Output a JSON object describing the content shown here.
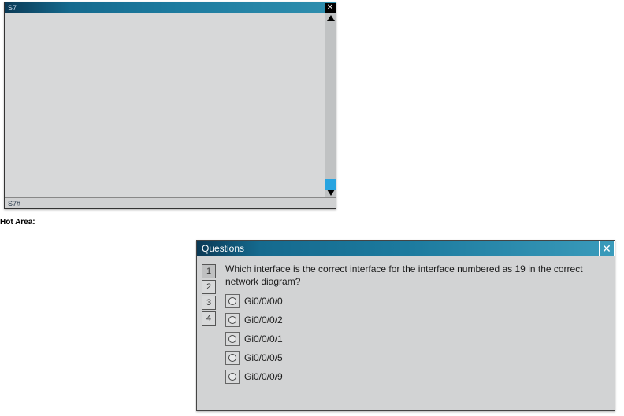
{
  "terminal": {
    "title": "S7",
    "status_prompt": "S7#"
  },
  "hot_area_label": "Hot Area:",
  "questions": {
    "title": "Questions",
    "nav": [
      "1",
      "2",
      "3",
      "4"
    ],
    "active_index": 0,
    "question_text": "Which interface is the correct interface for the interface numbered as 19 in the correct network diagram?",
    "options": [
      {
        "label": "Gi0/0/0/0"
      },
      {
        "label": "Gi0/0/0/2"
      },
      {
        "label": "Gi0/0/0/1"
      },
      {
        "label": "Gi0/0/0/5"
      },
      {
        "label": "Gi0/0/0/9"
      }
    ]
  }
}
